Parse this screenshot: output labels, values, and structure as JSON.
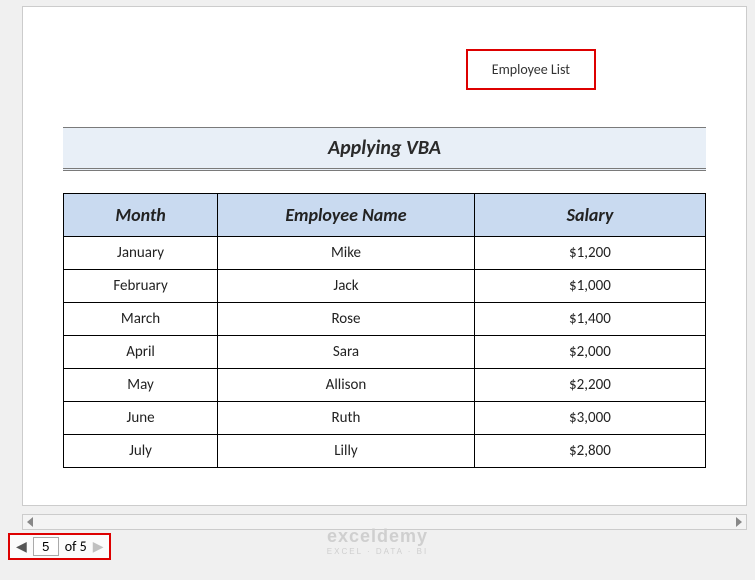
{
  "header": {
    "title": "Employee List"
  },
  "band": {
    "title": "Applying VBA"
  },
  "table": {
    "headers": {
      "month": "Month",
      "name": "Employee Name",
      "salary": "Salary"
    },
    "rows": [
      {
        "month": "January",
        "name": "Mike",
        "salary": "$1,200"
      },
      {
        "month": "February",
        "name": "Jack",
        "salary": "$1,000"
      },
      {
        "month": "March",
        "name": "Rose",
        "salary": "$1,400"
      },
      {
        "month": "April",
        "name": "Sara",
        "salary": "$2,000"
      },
      {
        "month": "May",
        "name": "Allison",
        "salary": "$2,200"
      },
      {
        "month": "June",
        "name": "Ruth",
        "salary": "$3,000"
      },
      {
        "month": "July",
        "name": "Lilly",
        "salary": "$2,800"
      }
    ]
  },
  "pager": {
    "current": "5",
    "total_label": "of 5"
  },
  "watermark": {
    "main": "exceldemy",
    "sub": "EXCEL · DATA · BI"
  }
}
